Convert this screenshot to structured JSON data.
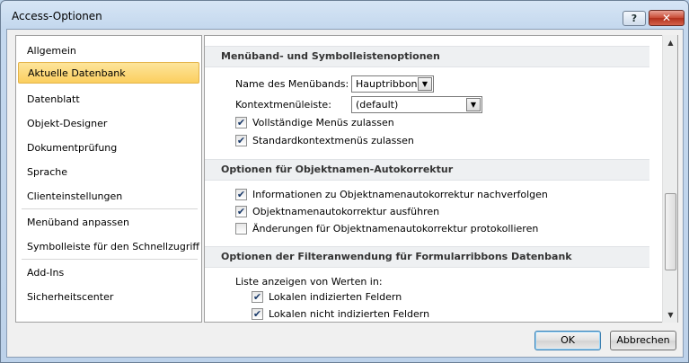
{
  "window": {
    "title": "Access-Optionen",
    "help_label": "?",
    "close_label": "✕"
  },
  "nav": {
    "items": [
      {
        "label": "Allgemein",
        "selected": false
      },
      {
        "label": "Aktuelle Datenbank",
        "selected": true
      },
      {
        "label": "Datenblatt",
        "selected": false
      },
      {
        "label": "Objekt-Designer",
        "selected": false
      },
      {
        "label": "Dokumentprüfung",
        "selected": false
      },
      {
        "label": "Sprache",
        "selected": false
      },
      {
        "label": "Clienteinstellungen",
        "selected": false
      },
      {
        "label": "Menüband anpassen",
        "selected": false
      },
      {
        "label": "Symbolleiste für den Schnellzugriff",
        "selected": false
      },
      {
        "label": "Add-Ins",
        "selected": false
      },
      {
        "label": "Sicherheitscenter",
        "selected": false
      }
    ]
  },
  "content": {
    "section1": {
      "title": "Menüband- und Symbolleistenoptionen",
      "ribbon_name_label": "Name des Menübands:",
      "ribbon_name_value": "Hauptribbon",
      "context_menu_label": "Kontextmenüleiste:",
      "context_menu_value": "(default)",
      "full_menus_label": "Vollständige Menüs zulassen",
      "full_menus_checked": true,
      "default_context_label": "Standardkontextmenüs zulassen",
      "default_context_checked": true
    },
    "section2": {
      "title": "Optionen für Objektnamen-Autokorrektur",
      "track_label": "Informationen zu Objektnamenautokorrektur nachverfolgen",
      "track_checked": true,
      "perform_label": "Objektnamenautokorrektur ausführen",
      "perform_checked": true,
      "log_label": "Änderungen für Objektnamenautokorrektur protokollieren",
      "log_checked": false
    },
    "section3": {
      "title": "Optionen der Filteranwendung für Formularribbons Datenbank",
      "list_label": "Liste anzeigen von Werten in:",
      "indexed_label": "Lokalen indizierten Feldern",
      "indexed_checked": true,
      "nonindexed_label": "Lokalen nicht indizierten Feldern",
      "nonindexed_checked": true
    }
  },
  "buttons": {
    "ok": "OK",
    "cancel": "Abbrechen"
  },
  "icons": {
    "check": "✔",
    "dropdown": "▼",
    "scroll_up": "▲",
    "scroll_down": "▼"
  }
}
